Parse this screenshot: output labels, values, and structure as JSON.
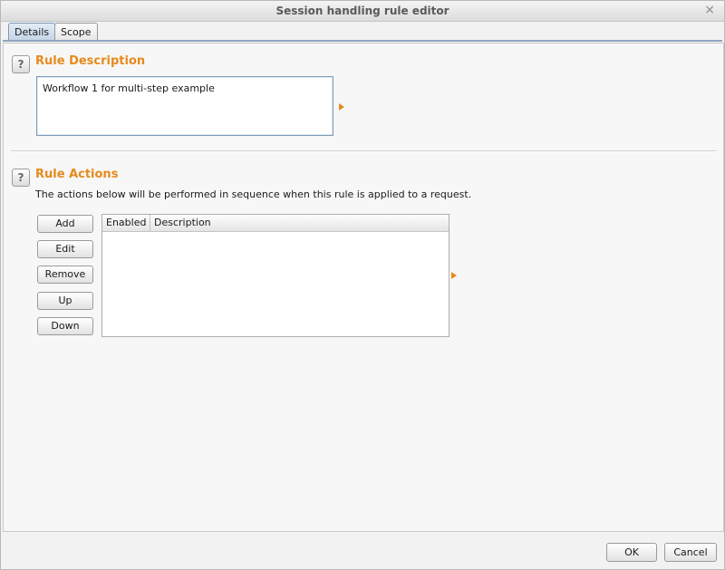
{
  "window": {
    "title": "Session handling rule editor",
    "close_glyph": "×"
  },
  "tabs": [
    {
      "label": "Details",
      "active": true
    },
    {
      "label": "Scope",
      "active": false
    }
  ],
  "rule_description": {
    "help_glyph": "?",
    "title": "Rule Description",
    "value": "Workflow 1 for multi-step example"
  },
  "rule_actions": {
    "help_glyph": "?",
    "title": "Rule Actions",
    "help_text": "The actions below will be performed in sequence when this rule is applied to a request.",
    "buttons": {
      "add": "Add",
      "edit": "Edit",
      "remove": "Remove",
      "up": "Up",
      "down": "Down"
    },
    "table": {
      "columns": [
        "Enabled",
        "Description"
      ],
      "rows": []
    }
  },
  "footer": {
    "ok": "OK",
    "cancel": "Cancel"
  },
  "colors": {
    "section_title": "#e68a1c",
    "arrow": "#e68a1c",
    "tab_active": "#c4d4e6"
  },
  "icons": {
    "help": "help-icon",
    "expand_arrow": "expand-arrow-icon",
    "close": "close-icon"
  }
}
